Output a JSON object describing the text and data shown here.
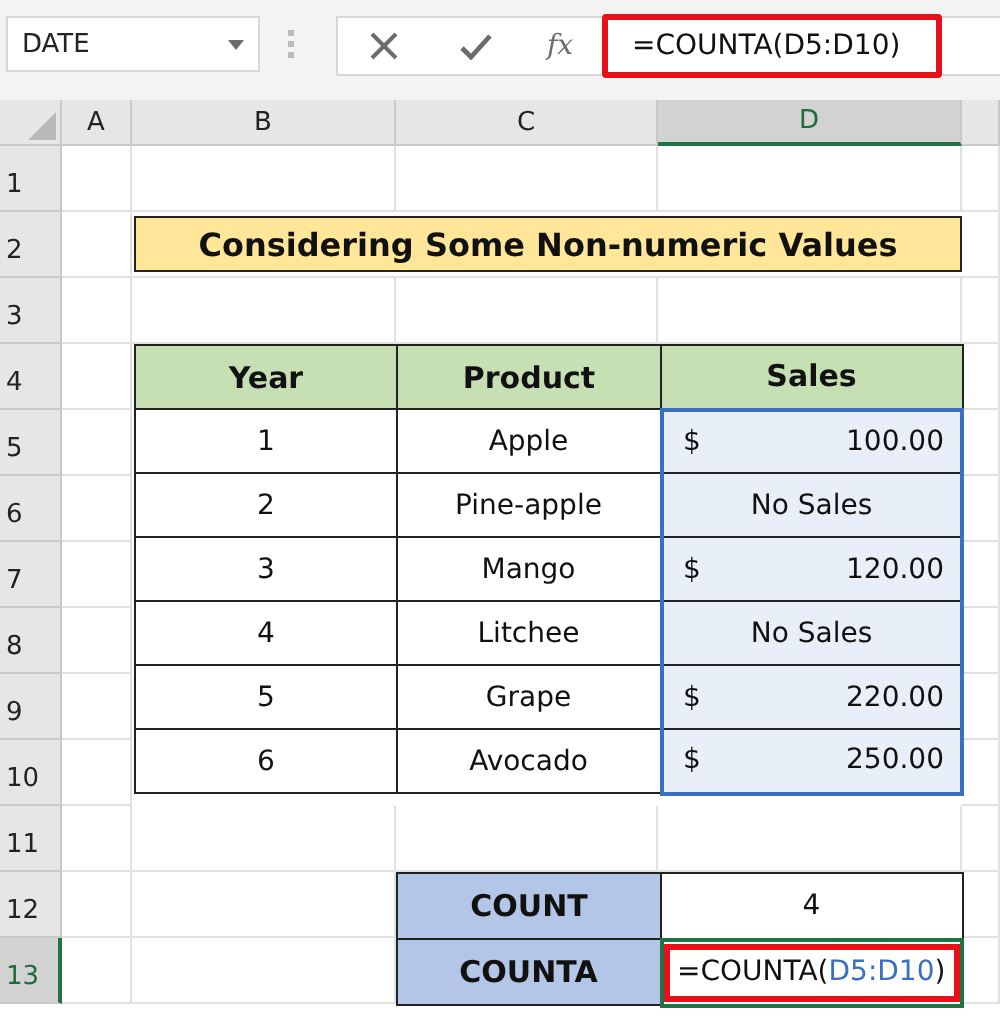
{
  "name_box": {
    "value": "DATE"
  },
  "formula_bar": {
    "fx_label": "fx",
    "formula": "=COUNTA(D5:D10)",
    "highlighted": true
  },
  "columns": [
    {
      "label": "A",
      "selected": false
    },
    {
      "label": "B",
      "selected": false
    },
    {
      "label": "C",
      "selected": false
    },
    {
      "label": "D",
      "selected": true
    }
  ],
  "rows": [
    {
      "label": "1",
      "selected": false
    },
    {
      "label": "2",
      "selected": false
    },
    {
      "label": "3",
      "selected": false
    },
    {
      "label": "4",
      "selected": false
    },
    {
      "label": "5",
      "selected": false
    },
    {
      "label": "6",
      "selected": false
    },
    {
      "label": "7",
      "selected": false
    },
    {
      "label": "8",
      "selected": false
    },
    {
      "label": "9",
      "selected": false
    },
    {
      "label": "10",
      "selected": false
    },
    {
      "label": "11",
      "selected": false
    },
    {
      "label": "12",
      "selected": false
    },
    {
      "label": "13",
      "selected": true
    }
  ],
  "title": "Considering Some Non-numeric Values",
  "table": {
    "columns": [
      "Year",
      "Product",
      "Sales"
    ],
    "rows": [
      {
        "year": "1",
        "product": "Apple",
        "sales": {
          "kind": "amount",
          "currency": "$",
          "amount": "100.00"
        }
      },
      {
        "year": "2",
        "product": "Pine-apple",
        "sales": {
          "kind": "text",
          "text": "No Sales"
        }
      },
      {
        "year": "3",
        "product": "Mango",
        "sales": {
          "kind": "amount",
          "currency": "$",
          "amount": "120.00"
        }
      },
      {
        "year": "4",
        "product": "Litchee",
        "sales": {
          "kind": "text",
          "text": "No Sales"
        }
      },
      {
        "year": "5",
        "product": "Grape",
        "sales": {
          "kind": "amount",
          "currency": "$",
          "amount": "220.00"
        }
      },
      {
        "year": "6",
        "product": "Avocado",
        "sales": {
          "kind": "amount",
          "currency": "$",
          "amount": "250.00"
        }
      }
    ]
  },
  "summary": [
    {
      "label": "COUNT",
      "kind": "value",
      "value": "4"
    },
    {
      "label": "COUNTA",
      "kind": "editing",
      "formula_start": "=COUNTA(",
      "reference": "D5:D10",
      "formula_end": ")",
      "highlighted": true
    }
  ]
}
